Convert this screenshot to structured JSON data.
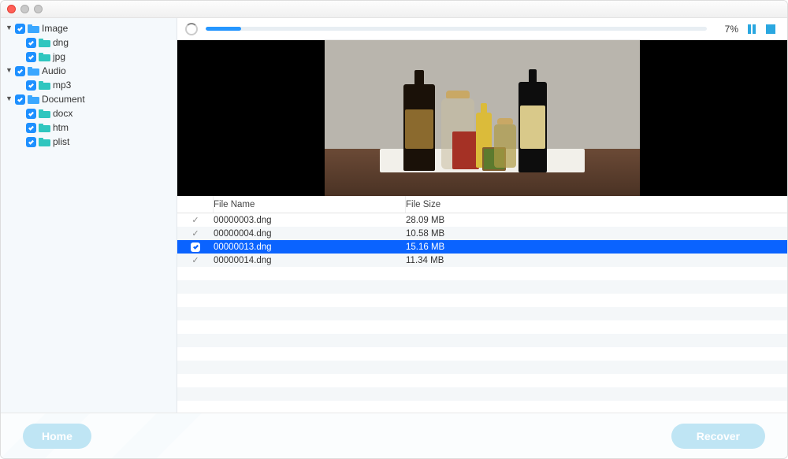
{
  "progress": {
    "percent_label": "7%",
    "percent_value": 7
  },
  "controls": {
    "pause_icon": "pause",
    "stop_icon": "stop"
  },
  "sidebar": {
    "groups": [
      {
        "label": "Image",
        "children": [
          {
            "label": "dng"
          },
          {
            "label": "jpg"
          }
        ]
      },
      {
        "label": "Audio",
        "children": [
          {
            "label": "mp3"
          }
        ]
      },
      {
        "label": "Document",
        "children": [
          {
            "label": "docx"
          },
          {
            "label": "htm"
          },
          {
            "label": "plist"
          }
        ]
      }
    ]
  },
  "table": {
    "columns": {
      "name": "File Name",
      "size": "File Size"
    },
    "rows": [
      {
        "name": "00000003.dng",
        "size": "28.09 MB",
        "checked": true,
        "selected": false
      },
      {
        "name": "00000004.dng",
        "size": "10.58 MB",
        "checked": true,
        "selected": false
      },
      {
        "name": "00000013.dng",
        "size": "15.16 MB",
        "checked": true,
        "selected": true
      },
      {
        "name": "00000014.dng",
        "size": "11.34 MB",
        "checked": true,
        "selected": false
      }
    ]
  },
  "footer": {
    "home": "Home",
    "recover": "Recover"
  },
  "preview": {
    "description": "Still-life photo: bottles and jars on a white cloth atop a wooden table against a light gray wall"
  }
}
